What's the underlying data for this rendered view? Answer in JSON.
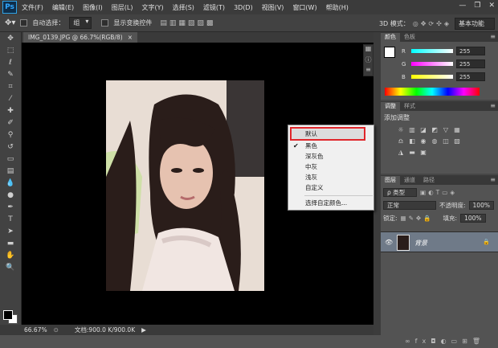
{
  "app": {
    "logo": "Ps"
  },
  "menu": [
    "文件(F)",
    "编辑(E)",
    "图像(I)",
    "图层(L)",
    "文字(Y)",
    "选择(S)",
    "滤镜(T)",
    "3D(D)",
    "视图(V)",
    "窗口(W)",
    "帮助(H)"
  ],
  "window_controls": {
    "minimize": "—",
    "restore": "❐",
    "close": "✕"
  },
  "options": {
    "auto_select_label": "自动选择：",
    "auto_select_value": "组",
    "show_transform_label": "显示变换控件",
    "mode_label": "3D 模式：",
    "workspace": "基本功能"
  },
  "document": {
    "tab_title": "IMG_0139.JPG @ 66.7%(RGB/8)",
    "close": "×"
  },
  "status": {
    "zoom": "66.67%",
    "doc_info": "文档:900.0 K/900.0K"
  },
  "panels": {
    "color": {
      "tabs": [
        "颜色",
        "色板"
      ],
      "channels": [
        {
          "label": "R",
          "value": "255",
          "color": "#ff4d4d"
        },
        {
          "label": "G",
          "value": "255",
          "color": "#4dff4d"
        },
        {
          "label": "B",
          "value": "255",
          "color": "#4d6bff"
        }
      ]
    },
    "adjustments": {
      "tabs": [
        "调整",
        "样式"
      ],
      "title": "添加调整"
    },
    "layers": {
      "tabs": [
        "图层",
        "通道",
        "路径"
      ],
      "filter_label": "ρ 类型",
      "blend_mode": "正常",
      "opacity_label": "不透明度:",
      "opacity_value": "100%",
      "lock_label": "锁定:",
      "fill_label": "填充:",
      "fill_value": "100%",
      "layer_name": "背景"
    }
  },
  "context_menu": {
    "items": [
      "默认",
      "黑色",
      "深灰色",
      "中灰",
      "浅灰",
      "自定义"
    ],
    "custom_color": "选择自定颜色...",
    "checked_item": "黑色",
    "highlight_color": "#e0262b"
  }
}
